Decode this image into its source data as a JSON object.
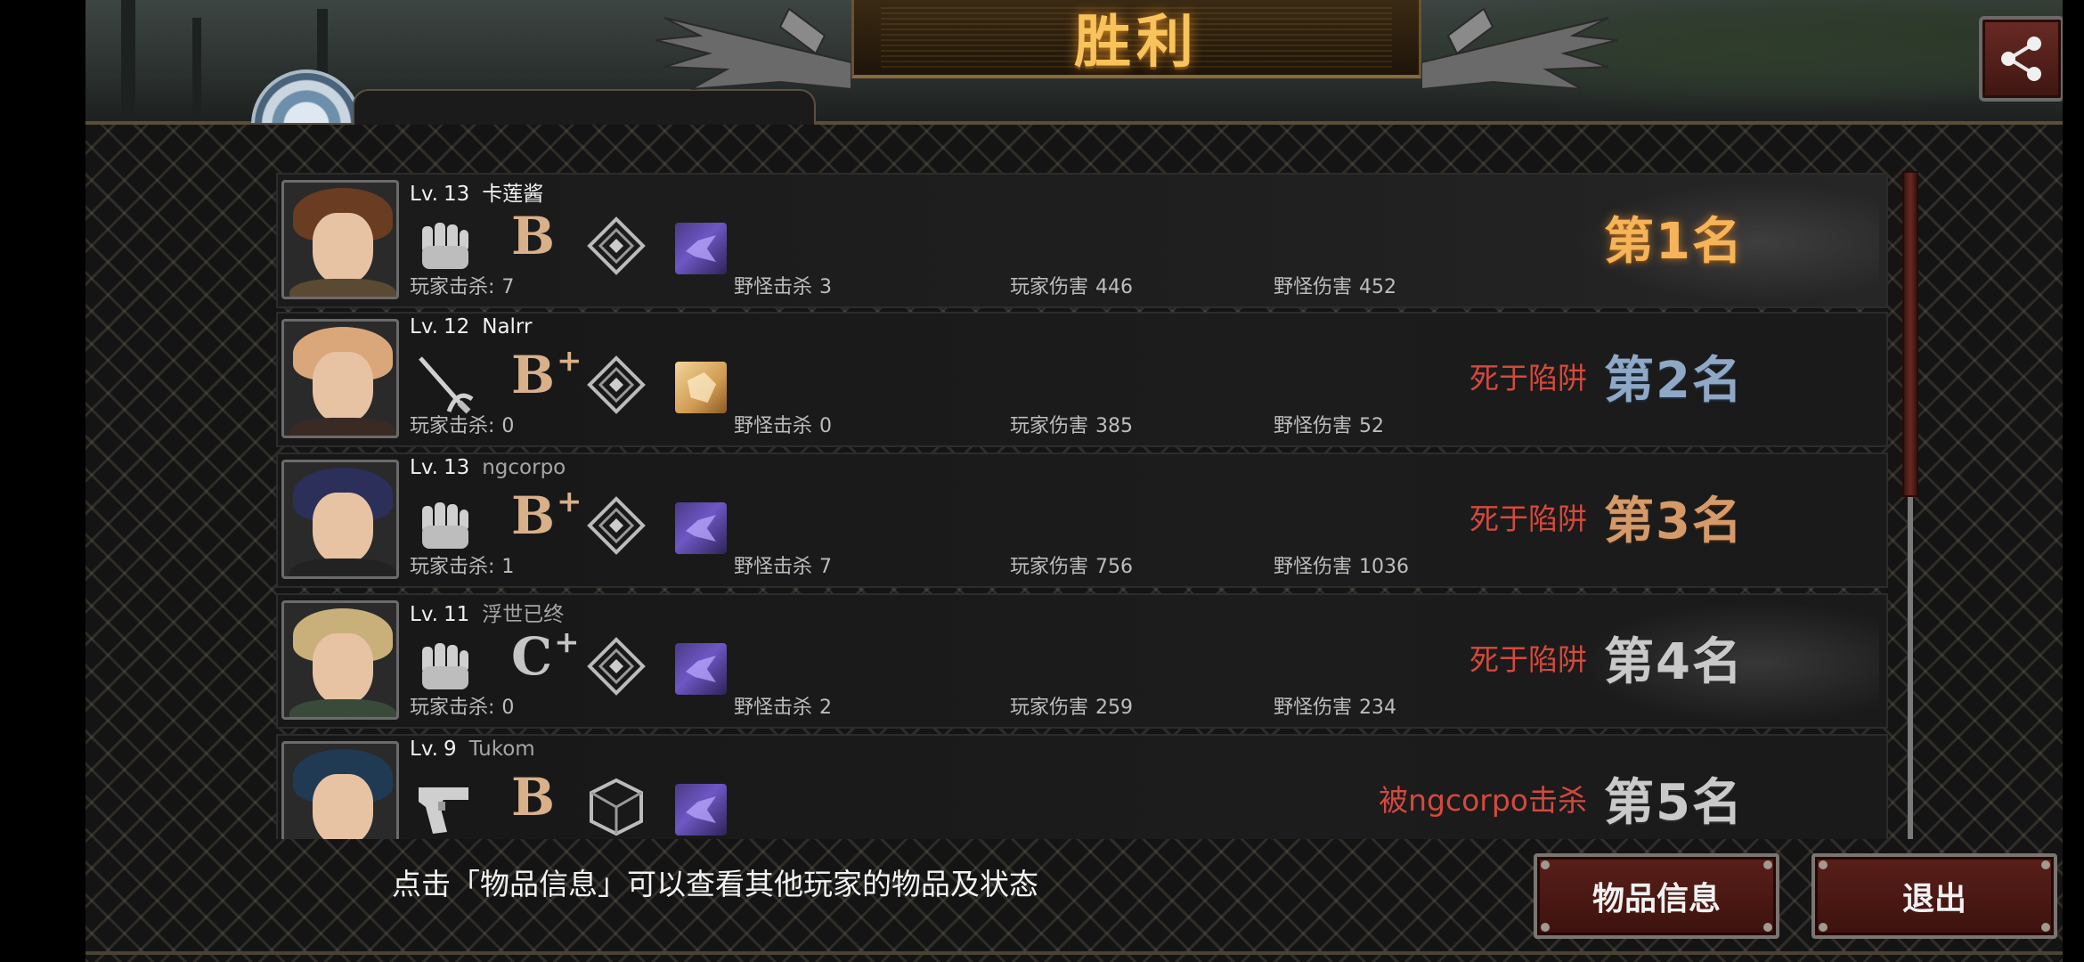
{
  "header": {
    "title": "胜利",
    "share_icon": "share-icon"
  },
  "players": [
    {
      "level_label": "Lv.",
      "level": "13",
      "name": "卡莲酱",
      "name_dim": false,
      "weapon_icon": "fist-icon",
      "grade": "B",
      "grade_plus": "",
      "grade_color": "#d8b08a",
      "skill_icon": "diamond-icon",
      "item_icon": "purple-item-icon",
      "player_kills_label": "玩家击杀:",
      "player_kills": "7",
      "monster_kills_label": "野怪击杀",
      "monster_kills": "3",
      "player_damage_label": "玩家伤害",
      "player_damage": "446",
      "monster_damage_label": "野怪伤害",
      "monster_damage": "452",
      "death_cause": "",
      "rank": "第1名"
    },
    {
      "level_label": "Lv.",
      "level": "12",
      "name": "Nalrr",
      "name_dim": false,
      "weapon_icon": "rapier-icon",
      "grade": "B",
      "grade_plus": "+",
      "grade_color": "#d8b08a",
      "skill_icon": "diamond-icon",
      "item_icon": "gold-item-icon",
      "player_kills_label": "玩家击杀:",
      "player_kills": "0",
      "monster_kills_label": "野怪击杀",
      "monster_kills": "0",
      "player_damage_label": "玩家伤害",
      "player_damage": "385",
      "monster_damage_label": "野怪伤害",
      "monster_damage": "52",
      "death_cause": "死于陷阱",
      "rank": "第2名"
    },
    {
      "level_label": "Lv.",
      "level": "13",
      "name": "ngcorpo",
      "name_dim": true,
      "weapon_icon": "fist-icon",
      "grade": "B",
      "grade_plus": "+",
      "grade_color": "#d8b08a",
      "skill_icon": "diamond-icon",
      "item_icon": "purple-item-icon",
      "player_kills_label": "玩家击杀:",
      "player_kills": "1",
      "monster_kills_label": "野怪击杀",
      "monster_kills": "7",
      "player_damage_label": "玩家伤害",
      "player_damage": "756",
      "monster_damage_label": "野怪伤害",
      "monster_damage": "1036",
      "death_cause": "死于陷阱",
      "rank": "第3名"
    },
    {
      "level_label": "Lv.",
      "level": "11",
      "name": "浮世已终",
      "name_dim": true,
      "weapon_icon": "fist-icon",
      "grade": "C",
      "grade_plus": "+",
      "grade_color": "#c5c5c5",
      "skill_icon": "diamond-icon",
      "item_icon": "purple-item-icon",
      "player_kills_label": "玩家击杀:",
      "player_kills": "0",
      "monster_kills_label": "野怪击杀",
      "monster_kills": "2",
      "player_damage_label": "玩家伤害",
      "player_damage": "259",
      "monster_damage_label": "野怪伤害",
      "monster_damage": "234",
      "death_cause": "死于陷阱",
      "rank": "第4名"
    },
    {
      "level_label": "Lv.",
      "level": "9",
      "name": "Tukom",
      "name_dim": true,
      "weapon_icon": "pistol-icon",
      "grade": "B",
      "grade_plus": "",
      "grade_color": "#d8b08a",
      "skill_icon": "cube-icon",
      "item_icon": "purple-item-icon",
      "player_kills_label": "",
      "player_kills": "",
      "monster_kills_label": "",
      "monster_kills": "",
      "player_damage_label": "",
      "player_damage": "",
      "monster_damage_label": "",
      "monster_damage": "",
      "death_cause": "被ngcorpo击杀",
      "rank": "第5名"
    }
  ],
  "footer": {
    "hint": "点击「物品信息」可以查看其他玩家的物品及状态",
    "items_button": "物品信息",
    "exit_button": "退出"
  }
}
